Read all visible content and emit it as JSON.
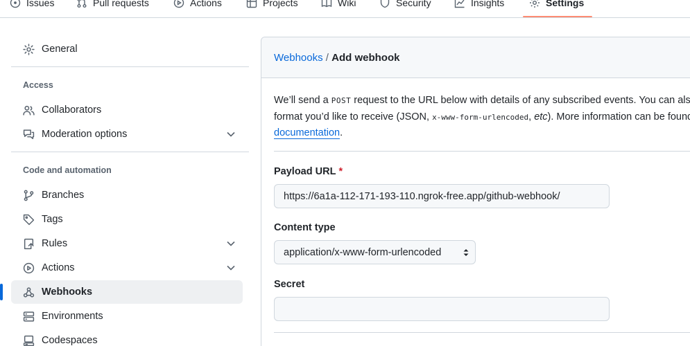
{
  "repo_nav": {
    "tabs": [
      {
        "label": "Issues",
        "icon": "issue-icon"
      },
      {
        "label": "Pull requests",
        "icon": "pull-request-icon"
      },
      {
        "label": "Actions",
        "icon": "play-icon"
      },
      {
        "label": "Projects",
        "icon": "table-icon"
      },
      {
        "label": "Wiki",
        "icon": "book-icon"
      },
      {
        "label": "Security",
        "icon": "shield-icon"
      },
      {
        "label": "Insights",
        "icon": "graph-icon"
      },
      {
        "label": "Settings",
        "icon": "gear-icon",
        "selected": true
      }
    ],
    "accent_color": "#fd8c73"
  },
  "sidebar": {
    "general": "General",
    "sections": [
      {
        "heading": "Access"
      },
      {
        "heading": "Code and automation"
      }
    ],
    "items": [
      {
        "label": "General"
      },
      {
        "label": "Collaborators"
      },
      {
        "label": "Moderation options"
      },
      {
        "label": "Branches"
      },
      {
        "label": "Tags"
      },
      {
        "label": "Rules"
      },
      {
        "label": "Actions"
      },
      {
        "label": "Webhooks",
        "active": true
      },
      {
        "label": "Environments"
      },
      {
        "label": "Codespaces"
      }
    ],
    "active_color": "#0969da"
  },
  "main": {
    "breadcrumb_parent": "Webhooks",
    "breadcrumb_sep": "/",
    "breadcrumb_current": "Add webhook",
    "intro_line1_a": "We’ll send a ",
    "intro_post": "POST",
    "intro_line1_b": " request to the URL below with details of any subscribed events. You can also specify which data",
    "intro_line2_a": "format you’d like to receive (JSON, ",
    "intro_code": "x-www-form-urlencoded",
    "intro_line2_b": ", ",
    "intro_etc": "etc",
    "intro_line2_c": "). More information can be found in our developer",
    "intro_link": "documentation",
    "intro_end": ".",
    "payload_label": "Payload URL",
    "required_mark": "*",
    "payload_value": "https://6a1a-112-171-193-110.ngrok-free.app/github-webhook/",
    "content_type_label": "Content type",
    "content_type_value": "application/x-www-form-urlencoded",
    "secret_label": "Secret",
    "secret_value": ""
  }
}
